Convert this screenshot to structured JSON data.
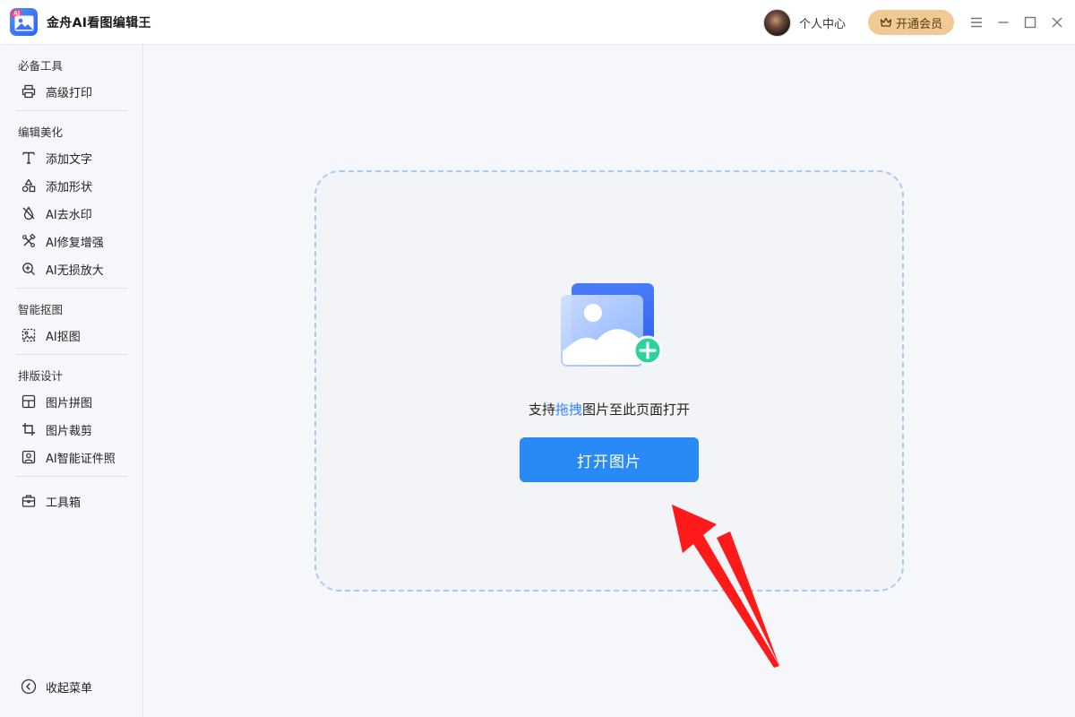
{
  "app": {
    "title": "金舟AI看图编辑王",
    "logo_tag": "AI"
  },
  "header": {
    "user_center": "个人中心",
    "vip_button": "开通会员"
  },
  "sidebar": {
    "sections": [
      {
        "title": "必备工具",
        "items": [
          {
            "label": "高级打印",
            "icon": "printer-icon"
          }
        ]
      },
      {
        "title": "编辑美化",
        "items": [
          {
            "label": "添加文字",
            "icon": "text-icon"
          },
          {
            "label": "添加形状",
            "icon": "shapes-icon"
          },
          {
            "label": "AI去水印",
            "icon": "watermark-drop-icon"
          },
          {
            "label": "AI修复增强",
            "icon": "repair-tools-icon"
          },
          {
            "label": "AI无损放大",
            "icon": "zoom-in-icon"
          }
        ]
      },
      {
        "title": "智能抠图",
        "items": [
          {
            "label": "AI抠图",
            "icon": "cutout-image-icon"
          }
        ]
      },
      {
        "title": "排版设计",
        "items": [
          {
            "label": "图片拼图",
            "icon": "collage-icon"
          },
          {
            "label": "图片裁剪",
            "icon": "crop-icon"
          },
          {
            "label": "AI智能证件照",
            "icon": "id-photo-icon"
          }
        ]
      }
    ],
    "toolbox": {
      "label": "工具箱",
      "icon": "toolbox-icon"
    },
    "collapse": {
      "label": "收起菜单",
      "icon": "chevron-left-circle-icon"
    }
  },
  "main": {
    "hint_prefix": "支持",
    "hint_highlight": "拖拽",
    "hint_suffix": "图片至此页面打开",
    "open_button": "打开图片"
  },
  "colors": {
    "accent": "#2a8af5",
    "vip": "#f0c994",
    "annotation_arrow": "#ff1a1a"
  }
}
